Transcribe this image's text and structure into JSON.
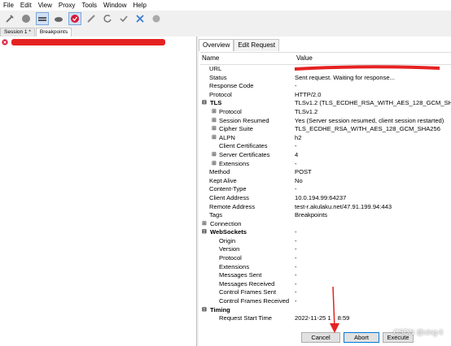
{
  "menu": [
    "File",
    "Edit",
    "View",
    "Proxy",
    "Tools",
    "Window",
    "Help"
  ],
  "tabs": [
    "Session 1 *",
    "Breakpoints"
  ],
  "right_tabs": [
    "Overview",
    "Edit Request"
  ],
  "grid_header": {
    "name": "Name",
    "value": "Value"
  },
  "rows": [
    {
      "name": "URL",
      "value": "",
      "indent": 1,
      "redacted": true
    },
    {
      "name": "Status",
      "value": "Sent request. Waiting for response...",
      "indent": 1
    },
    {
      "name": "Response Code",
      "value": "-",
      "indent": 1
    },
    {
      "name": "Protocol",
      "value": "HTTP/2.0",
      "indent": 1
    },
    {
      "name": "TLS",
      "value": "TLSv1.2 (TLS_ECDHE_RSA_WITH_AES_128_GCM_SHA256)",
      "indent": 0,
      "section": true,
      "exp": "⊟"
    },
    {
      "name": "Protocol",
      "value": "TLSv1.2",
      "indent": 2,
      "exp": "⊞"
    },
    {
      "name": "Session Resumed",
      "value": "Yes (Server session resumed, client session restarted)",
      "indent": 2,
      "exp": "⊞"
    },
    {
      "name": "Cipher Suite",
      "value": "TLS_ECDHE_RSA_WITH_AES_128_GCM_SHA256",
      "indent": 2,
      "exp": "⊞"
    },
    {
      "name": "ALPN",
      "value": "h2",
      "indent": 2,
      "exp": "⊞"
    },
    {
      "name": "Client Certificates",
      "value": "-",
      "indent": 2
    },
    {
      "name": "Server Certificates",
      "value": "4",
      "indent": 2,
      "exp": "⊞"
    },
    {
      "name": "Extensions",
      "value": "-",
      "indent": 2,
      "exp": "⊞"
    },
    {
      "name": "Method",
      "value": "POST",
      "indent": 1
    },
    {
      "name": "Kept Alive",
      "value": "No",
      "indent": 1
    },
    {
      "name": "Content-Type",
      "value": "-",
      "indent": 1
    },
    {
      "name": "Client Address",
      "value": "10.0.194.99:64237",
      "indent": 1
    },
    {
      "name": "Remote Address",
      "value": "test-r.akulaku.net/47.91.199.94:443",
      "indent": 1
    },
    {
      "name": "Tags",
      "value": "Breakpoints",
      "indent": 1
    },
    {
      "name": "Connection",
      "value": "",
      "indent": 0,
      "exp": "⊞"
    },
    {
      "name": "WebSockets",
      "value": "-",
      "indent": 0,
      "section": true,
      "exp": "⊟"
    },
    {
      "name": "Origin",
      "value": "-",
      "indent": 2
    },
    {
      "name": "Version",
      "value": "-",
      "indent": 2
    },
    {
      "name": "Protocol",
      "value": "-",
      "indent": 2
    },
    {
      "name": "Extensions",
      "value": "-",
      "indent": 2
    },
    {
      "name": "Messages Sent",
      "value": "-",
      "indent": 2
    },
    {
      "name": "Messages Received",
      "value": "-",
      "indent": 2
    },
    {
      "name": "Control Frames Sent",
      "value": "-",
      "indent": 2
    },
    {
      "name": "Control Frames Received",
      "value": "-",
      "indent": 2
    },
    {
      "name": "Timing",
      "value": "",
      "indent": 0,
      "section": true,
      "exp": "⊟"
    },
    {
      "name": "Request Start Time",
      "value": "2022-11-25 1",
      "value2": "8:59",
      "indent": 2
    }
  ],
  "buttons": {
    "cancel": "Cancel",
    "abort": "Abort",
    "execute": "Execute"
  },
  "watermark": "CSDN @xing-li",
  "colors": {
    "redact": "#e52222",
    "arrow": "#e52222",
    "accent": "#0078d7"
  }
}
